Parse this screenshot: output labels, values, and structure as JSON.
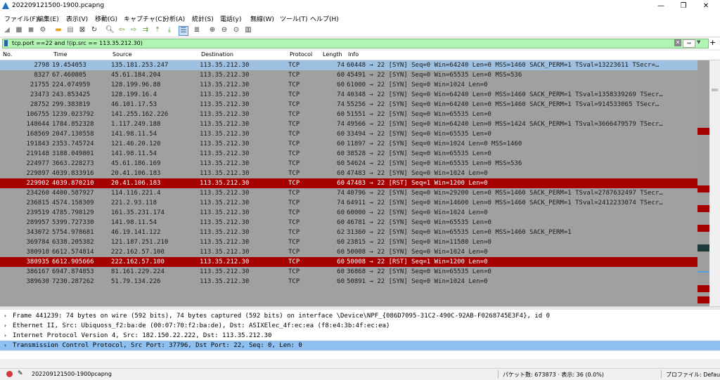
{
  "window": {
    "title": "202209121500-1900.pcapng",
    "minimize": "—",
    "maximize": "❐",
    "close": "✕"
  },
  "menu": [
    "ファイル(F)",
    "編集(E)",
    "表示(V)",
    "移動(G)",
    "キャプチャ(C)",
    "分析(A)",
    "統計(S)",
    "電話(y)",
    "無線(W)",
    "ツール(T)",
    "ヘルプ(H)"
  ],
  "toolbar_icons": [
    "start-capture-icon",
    "stop-capture-icon",
    "restart-capture-icon",
    "capture-options-icon",
    "open-file-icon",
    "save-file-icon",
    "close-file-icon",
    "reload-icon",
    "find-icon",
    "back-icon",
    "forward-icon",
    "go-to-packet-icon",
    "first-packet-icon",
    "last-packet-icon",
    "autoscroll-icon",
    "colorize-icon",
    "zoom-in-icon",
    "zoom-out-icon",
    "normal-size-icon",
    "resize-columns-icon"
  ],
  "filter": {
    "value": "tcp.port ==22 and !(ip.src == 113.35.212.30)",
    "plus": "+"
  },
  "columns": {
    "no": "No.",
    "time": "Time",
    "source": "Source",
    "destination": "Destination",
    "protocol": "Protocol",
    "length": "Length",
    "info": "Info"
  },
  "packets": [
    {
      "no": "2798",
      "time": "19.454053",
      "src": "135.181.253.247",
      "dst": "113.35.212.30",
      "proto": "TCP",
      "len": "74",
      "info": "60448 → 22 [SYN] Seq=0 Win=64240 Len=0 MSS=1460 SACK_PERM=1 TSval=13223611 TSecr=…",
      "state": "first"
    },
    {
      "no": "8327",
      "time": "67.460805",
      "src": "45.61.184.204",
      "dst": "113.35.212.30",
      "proto": "TCP",
      "len": "60",
      "info": "45491 → 22 [SYN] Seq=0 Win=65535 Len=0 MSS=536",
      "state": ""
    },
    {
      "no": "21755",
      "time": "224.074959",
      "src": "128.199.96.88",
      "dst": "113.35.212.30",
      "proto": "TCP",
      "len": "60",
      "info": "61000 → 22 [SYN] Seq=0 Win=1024 Len=0",
      "state": ""
    },
    {
      "no": "23473",
      "time": "243.853425",
      "src": "128.199.16.4",
      "dst": "113.35.212.30",
      "proto": "TCP",
      "len": "74",
      "info": "40348 → 22 [SYN] Seq=0 Win=64240 Len=0 MSS=1460 SACK_PERM=1 TSval=1358339269 TSecr…",
      "state": ""
    },
    {
      "no": "28752",
      "time": "299.383819",
      "src": "46.101.17.53",
      "dst": "113.35.212.30",
      "proto": "TCP",
      "len": "74",
      "info": "55256 → 22 [SYN] Seq=0 Win=64240 Len=0 MSS=1460 SACK_PERM=1 TSval=914533065 TSecr…",
      "state": ""
    },
    {
      "no": "106755",
      "time": "1239.023792",
      "src": "141.255.162.226",
      "dst": "113.35.212.30",
      "proto": "TCP",
      "len": "60",
      "info": "51551 → 22 [SYN] Seq=0 Win=65535 Len=0",
      "state": ""
    },
    {
      "no": "148644",
      "time": "1784.852328",
      "src": "1.117.249.188",
      "dst": "113.35.212.30",
      "proto": "TCP",
      "len": "74",
      "info": "49566 → 22 [SYN] Seq=0 Win=64240 Len=0 MSS=1424 SACK_PERM=1 TSval=3666479579 TSecr…",
      "state": ""
    },
    {
      "no": "168569",
      "time": "2047.130558",
      "src": "141.98.11.54",
      "dst": "113.35.212.30",
      "proto": "TCP",
      "len": "60",
      "info": "33494 → 22 [SYN] Seq=0 Win=65535 Len=0",
      "state": ""
    },
    {
      "no": "191843",
      "time": "2353.745724",
      "src": "121.46.20.120",
      "dst": "113.35.212.30",
      "proto": "TCP",
      "len": "60",
      "info": "11897 → 22 [SYN] Seq=0 Win=1024 Len=0 MSS=1460",
      "state": ""
    },
    {
      "no": "219148",
      "time": "3188.049801",
      "src": "141.98.11.54",
      "dst": "113.35.212.30",
      "proto": "TCP",
      "len": "60",
      "info": "38528 → 22 [SYN] Seq=0 Win=65535 Len=0",
      "state": ""
    },
    {
      "no": "224977",
      "time": "3663.228273",
      "src": "45.61.186.169",
      "dst": "113.35.212.30",
      "proto": "TCP",
      "len": "60",
      "info": "54624 → 22 [SYN] Seq=0 Win=65535 Len=0 MSS=536",
      "state": ""
    },
    {
      "no": "229897",
      "time": "4039.833916",
      "src": "20.41.106.183",
      "dst": "113.35.212.30",
      "proto": "TCP",
      "len": "60",
      "info": "47483 → 22 [SYN] Seq=0 Win=1024 Len=0",
      "state": ""
    },
    {
      "no": "229902",
      "time": "4039.870210",
      "src": "20.41.106.183",
      "dst": "113.35.212.30",
      "proto": "TCP",
      "len": "60",
      "info": "47483 → 22 [RST] Seq=1 Win=1200 Len=0",
      "state": "rst"
    },
    {
      "no": "234260",
      "time": "4400.587927",
      "src": "114.116.221.4",
      "dst": "113.35.212.30",
      "proto": "TCP",
      "len": "74",
      "info": "40796 → 22 [SYN] Seq=0 Win=29200 Len=0 MSS=1460 SACK_PERM=1 TSval=2787632497 TSecr…",
      "state": ""
    },
    {
      "no": "236815",
      "time": "4574.158309",
      "src": "221.2.93.118",
      "dst": "113.35.212.30",
      "proto": "TCP",
      "len": "74",
      "info": "64911 → 22 [SYN] Seq=0 Win=14600 Len=0 MSS=1460 SACK_PERM=1 TSval=2412233074 TSecr…",
      "state": ""
    },
    {
      "no": "239519",
      "time": "4785.798129",
      "src": "161.35.231.174",
      "dst": "113.35.212.30",
      "proto": "TCP",
      "len": "60",
      "info": "60000 → 22 [SYN] Seq=0 Win=1024 Len=0",
      "state": ""
    },
    {
      "no": "289957",
      "time": "5399.727330",
      "src": "141.98.11.54",
      "dst": "113.35.212.30",
      "proto": "TCP",
      "len": "60",
      "info": "46781 → 22 [SYN] Seq=0 Win=65535 Len=0",
      "state": ""
    },
    {
      "no": "343072",
      "time": "5754.978681",
      "src": "46.19.141.122",
      "dst": "113.35.212.30",
      "proto": "TCP",
      "len": "62",
      "info": "31360 → 22 [SYN] Seq=0 Win=65535 Len=0 MSS=1460 SACK_PERM=1",
      "state": ""
    },
    {
      "no": "369784",
      "time": "6338.205382",
      "src": "121.187.251.210",
      "dst": "113.35.212.30",
      "proto": "TCP",
      "len": "60",
      "info": "23815 → 22 [SYN] Seq=0 Win=11580 Len=0",
      "state": ""
    },
    {
      "no": "380918",
      "time": "6612.574814",
      "src": "222.162.57.100",
      "dst": "113.35.212.30",
      "proto": "TCP",
      "len": "60",
      "info": "50008 → 22 [SYN] Seq=0 Win=1024 Len=0",
      "state": ""
    },
    {
      "no": "380935",
      "time": "6612.905666",
      "src": "222.162.57.100",
      "dst": "113.35.212.30",
      "proto": "TCP",
      "len": "60",
      "info": "50008 → 22 [RST] Seq=1 Win=1200 Len=0",
      "state": "rst"
    },
    {
      "no": "386167",
      "time": "6947.874853",
      "src": "81.161.229.224",
      "dst": "113.35.212.30",
      "proto": "TCP",
      "len": "60",
      "info": "36868 → 22 [SYN] Seq=0 Win=65535 Len=0",
      "state": ""
    },
    {
      "no": "389630",
      "time": "7230.287262",
      "src": "51.79.134.226",
      "dst": "113.35.212.30",
      "proto": "TCP",
      "len": "60",
      "info": "50891 → 22 [SYN] Seq=0 Win=1024 Len=0",
      "state": ""
    }
  ],
  "details": [
    {
      "expander": "›",
      "text": "Frame 441239: 74 bytes on wire (592 bits), 74 bytes captured (592 bits) on interface \\Device\\NPF_{086D7095-31C2-490C-92AB-F0268745E3F4}, id 0",
      "selected": false
    },
    {
      "expander": "›",
      "text": "Ethernet II, Src: Ubiquoss_f2:ba:de (00:07:70:f2:ba:de), Dst: ASIXElec_4f:ec:ea (f8:e4:3b:4f:ec:ea)",
      "selected": false
    },
    {
      "expander": "›",
      "text": "Internet Protocol Version 4, Src: 182.150.22.222, Dst: 113.35.212.30",
      "selected": false
    },
    {
      "expander": "›",
      "text": "Transmission Control Protocol, Src Port: 37796, Dst Port: 22, Seq: 0, Len: 0",
      "selected": true
    }
  ],
  "status": {
    "file": "202209121500-1900pcapng",
    "packets": "パケット数: 673873 · 表示: 36 (0.0%)",
    "profile": "プロファイル: Default"
  },
  "colors": {
    "rst": "#a40000",
    "row": "#a0a0a0",
    "filter": "#b2f5b2",
    "detail_selected": "#90c0f0"
  }
}
